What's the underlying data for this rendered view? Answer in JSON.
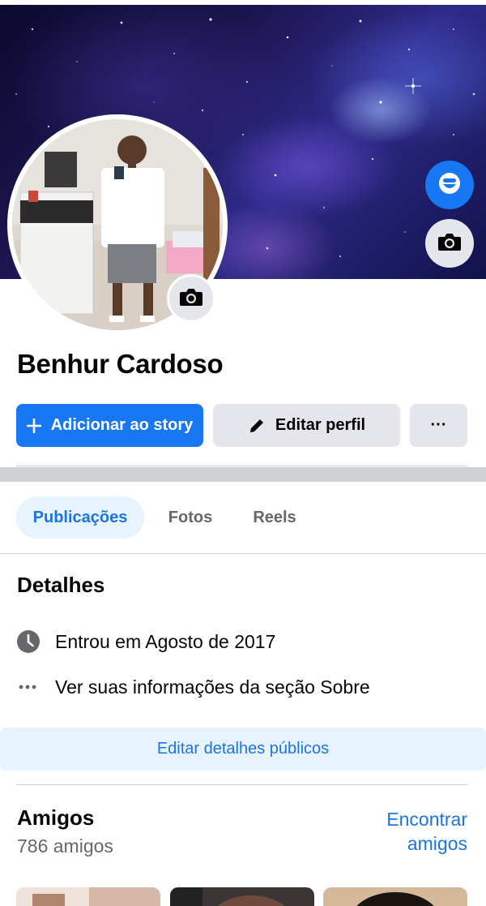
{
  "profile": {
    "name": "Benhur Cardoso"
  },
  "actions": {
    "add_story_label": "Adicionar ao story",
    "edit_profile_label": "Editar perfil",
    "more_label": "···"
  },
  "tabs": [
    {
      "label": "Publicações",
      "active": true
    },
    {
      "label": "Fotos",
      "active": false
    },
    {
      "label": "Reels",
      "active": false
    }
  ],
  "details": {
    "title": "Detalhes",
    "joined": "Entrou em Agosto de 2017",
    "about_link": "Ver suas informações da seção Sobre",
    "edit_button": "Editar detalhes públicos"
  },
  "friends": {
    "title": "Amigos",
    "count": "786 amigos",
    "find_friends": "Encontrar amigos"
  },
  "icons": {
    "avatar_badge": "avatar-icon",
    "cover_camera": "camera-icon",
    "profile_camera": "camera-icon",
    "story_add": "plus-icon",
    "edit": "pencil-icon",
    "more": "more-dots-icon",
    "joined": "clock-icon",
    "about": "more-dots-icon"
  },
  "colors": {
    "accent": "#1877f2",
    "link": "#1b74e4",
    "secondary_button": "#e4e6eb",
    "tab_active_bg": "#e7f3ff",
    "muted_text": "#65676b"
  }
}
